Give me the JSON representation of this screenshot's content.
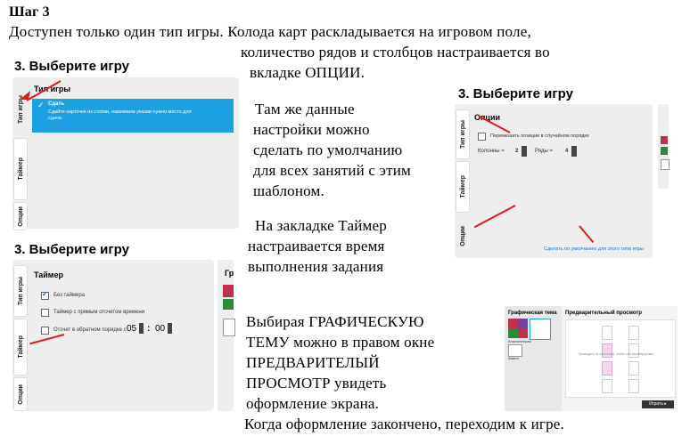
{
  "step": {
    "title": "Шаг 3"
  },
  "intro": {
    "line1": "Доступен только один тип игры. Колода карт раскладывается на игровом поле,",
    "line2": "количество рядов и столбцов настраивается во",
    "line3": "вкладке ОПЦИИ."
  },
  "defaults_text": {
    "l1": "Там же данные",
    "l2": "настройки можно",
    "l3": "сделать по умолчанию",
    "l4": "для всех занятий с этим",
    "l5": "шаблоном."
  },
  "timer_text": {
    "l1": "На закладке Таймер",
    "l2": "настраивается время",
    "l3": "выполнения задания"
  },
  "theme_text": {
    "l1": "Выбирая ГРАФИЧЕСКУЮ",
    "l2": "ТЕМУ можно в правом окне",
    "l3": "ПРЕДВАРИТЕЛЫЙ",
    "l4": "ПРОСМОТР увидеть",
    "l5": "оформление экрана."
  },
  "final_text": "Когда оформление закончено, переходим к игре.",
  "shot1": {
    "title": "3.  Выберите игру",
    "tabs": [
      "Тип игры",
      "Таймер",
      "Опции"
    ],
    "section": "Тип игры",
    "option_title": "Сдать",
    "option_desc1": "Сдайте карточки из стопки, нажимаем указав нужно место для",
    "option_desc2": "сдачи."
  },
  "shot2": {
    "title": "3.  Выберите игру",
    "tabs": [
      "Тип игры",
      "Таймер",
      "Опции"
    ],
    "section": "Опции",
    "shuffle": "Перемешать позиции в случайном порядке",
    "columns_label": "Колонны =",
    "columns_value": "2",
    "rows_label": "Ряды =",
    "rows_value": "4",
    "default_link": "Сделать по умолчанию для этого типа игры"
  },
  "shot3": {
    "title": "3.  Выберите игру",
    "tabs": [
      "Тип игры",
      "Таймер",
      "Опции"
    ],
    "section": "Таймер",
    "opt_no_timer": "Без таймера",
    "opt_forward": "Таймер с прямым отсчетом времени",
    "opt_countdown": "Отсчет в обратном порядке с",
    "minutes": "05",
    "seconds": "00",
    "side_label": "Гр"
  },
  "shot4": {
    "theme_title": "Графическая тема",
    "preview_title": "Предварительный просмотр",
    "theme_item1": "Классическая",
    "theme_item2": "Камни",
    "preview_hint": "Проведите по карточкам, чтобы они перевернулись",
    "play_button": "Играть"
  },
  "colors": {
    "accent": "#1ba1e2",
    "arrow": "#e21a1a",
    "panel": "#eeeeee"
  }
}
